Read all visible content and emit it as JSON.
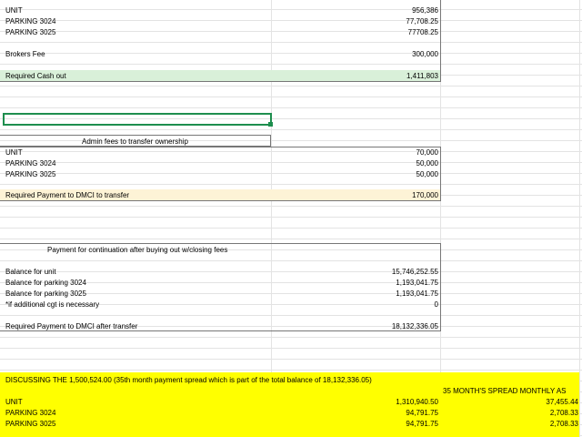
{
  "section1": {
    "unit_label": "UNIT",
    "unit_value": "956,386",
    "p3024_label": "PARKING 3024",
    "p3024_value": "77,708.25",
    "p3025_label": "PARKING 3025",
    "p3025_value": "77708.25",
    "brokers_label": "Brokers Fee",
    "brokers_value": "300,000",
    "total_label": "Required Cash out",
    "total_value": "1,411,803"
  },
  "section2": {
    "header": "Admin fees to transfer ownership",
    "unit_label": "UNIT",
    "unit_value": "70,000",
    "p3024_label": "PARKING 3024",
    "p3024_value": "50,000",
    "p3025_label": "PARKING 3025",
    "p3025_value": "50,000",
    "total_label": "Required Payment to DMCI to transfer",
    "total_value": "170,000"
  },
  "section3": {
    "header": "Payment for continuation after buying out w/closing fees",
    "unit_label": "Balance for unit",
    "unit_value": "15,746,252.55",
    "p3024_label": "Balance for  parking 3024",
    "p3024_value": "1,193,041.75",
    "p3025_label": "Balance for parking 3025",
    "p3025_value": "1,193,041.75",
    "cgt_label": "*if additional cgt is necessary",
    "cgt_value": "0",
    "total_label": "Required Payment to DMCI after transfer",
    "total_value": "18,132,336.05"
  },
  "section4": {
    "discussion": "DISCUSSING THE 1,500,524.00 (35th month payment spread which is part of the total balance of 18,132,336.05)",
    "spread_header": "35 MONTH'S SPREAD MONTHLY AS",
    "unit_label": "UNIT",
    "unit_value": "1,310,940.50",
    "unit_monthly": "37,455.44",
    "p3024_label": "PARKING 3024",
    "p3024_value": "94,791.75",
    "p3024_monthly": "2,708.33",
    "p3025_label": "PARKING 3025",
    "p3025_value": "94,791.75",
    "p3025_monthly": "2,708.33"
  },
  "colors": {
    "total_green": "#d9f0d9",
    "total_cream": "#fdf3d6",
    "highlight_yellow": "#ffff00",
    "selection_green": "#1e8e4e"
  }
}
